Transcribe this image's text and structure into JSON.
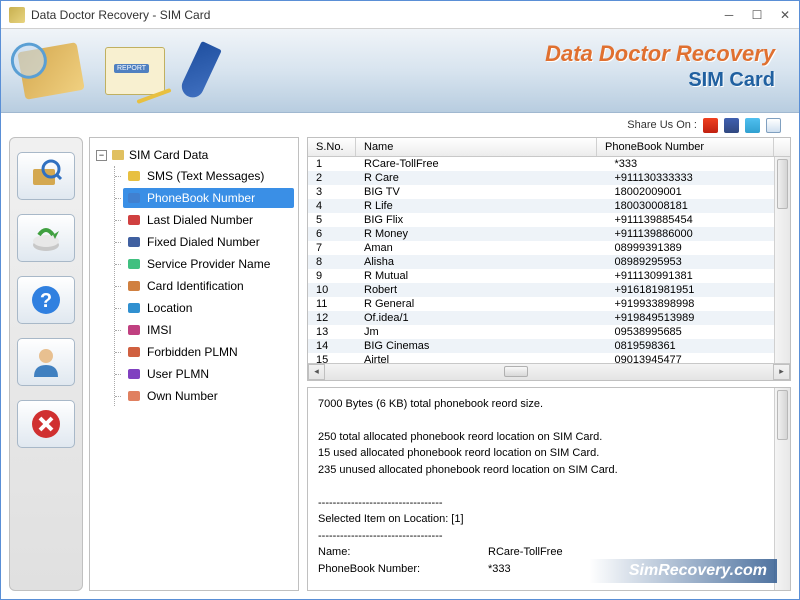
{
  "window": {
    "title": "Data Doctor Recovery - SIM Card"
  },
  "banner": {
    "line1": "Data Doctor Recovery",
    "line2": "SIM Card"
  },
  "share": {
    "label": "Share Us On :"
  },
  "toolbar_icons": [
    "search-sim",
    "export",
    "help",
    "user",
    "close"
  ],
  "tree": {
    "root": "SIM Card Data",
    "items": [
      {
        "label": "SMS (Text Messages)",
        "icon": "sms"
      },
      {
        "label": "PhoneBook Number",
        "icon": "phonebook",
        "selected": true
      },
      {
        "label": "Last Dialed Number",
        "icon": "dialed"
      },
      {
        "label": "Fixed Dialed Number",
        "icon": "fixed"
      },
      {
        "label": "Service Provider Name",
        "icon": "provider"
      },
      {
        "label": "Card Identification",
        "icon": "cardid"
      },
      {
        "label": "Location",
        "icon": "location"
      },
      {
        "label": "IMSI",
        "icon": "imsi"
      },
      {
        "label": "Forbidden PLMN",
        "icon": "forbidden"
      },
      {
        "label": "User PLMN",
        "icon": "userplmn"
      },
      {
        "label": "Own Number",
        "icon": "own"
      }
    ]
  },
  "table": {
    "headers": {
      "sno": "S.No.",
      "name": "Name",
      "number": "PhoneBook Number"
    },
    "rows": [
      {
        "sno": "1",
        "name": "RCare-TollFree",
        "number": "*333"
      },
      {
        "sno": "2",
        "name": "R Care",
        "number": "+911130333333"
      },
      {
        "sno": "3",
        "name": "BIG TV",
        "number": "18002009001"
      },
      {
        "sno": "4",
        "name": "R Life",
        "number": "180030008181"
      },
      {
        "sno": "5",
        "name": "BIG Flix",
        "number": "+911139885454"
      },
      {
        "sno": "6",
        "name": "R Money",
        "number": "+911139886000"
      },
      {
        "sno": "7",
        "name": "Aman",
        "number": "08999391389"
      },
      {
        "sno": "8",
        "name": "Alisha",
        "number": "08989295953"
      },
      {
        "sno": "9",
        "name": "R Mutual",
        "number": "+911130991381"
      },
      {
        "sno": "10",
        "name": "Robert",
        "number": "+916181981951"
      },
      {
        "sno": "11",
        "name": "R General",
        "number": "+919933898998"
      },
      {
        "sno": "12",
        "name": "Of.idea/1",
        "number": "+919849513989"
      },
      {
        "sno": "13",
        "name": "Jm",
        "number": "09538995685"
      },
      {
        "sno": "14",
        "name": "BIG Cinemas",
        "number": "0819598361"
      },
      {
        "sno": "15",
        "name": "Airtel",
        "number": "09013945477"
      }
    ]
  },
  "details": {
    "line1": "7000 Bytes (6 KB) total phonebook reord size.",
    "line2": "250 total allocated phonebook reord location on SIM Card.",
    "line3": "15 used allocated phonebook reord location on SIM Card.",
    "line4": "235 unused allocated phonebook reord location on SIM Card.",
    "sep": "----------------------------------",
    "selected": "Selected Item on Location: [1]",
    "name_label": "Name:",
    "name_value": "RCare-TollFree",
    "num_label": "PhoneBook Number:",
    "num_value": "*333"
  },
  "footer": {
    "brand": "SimRecovery.com"
  }
}
